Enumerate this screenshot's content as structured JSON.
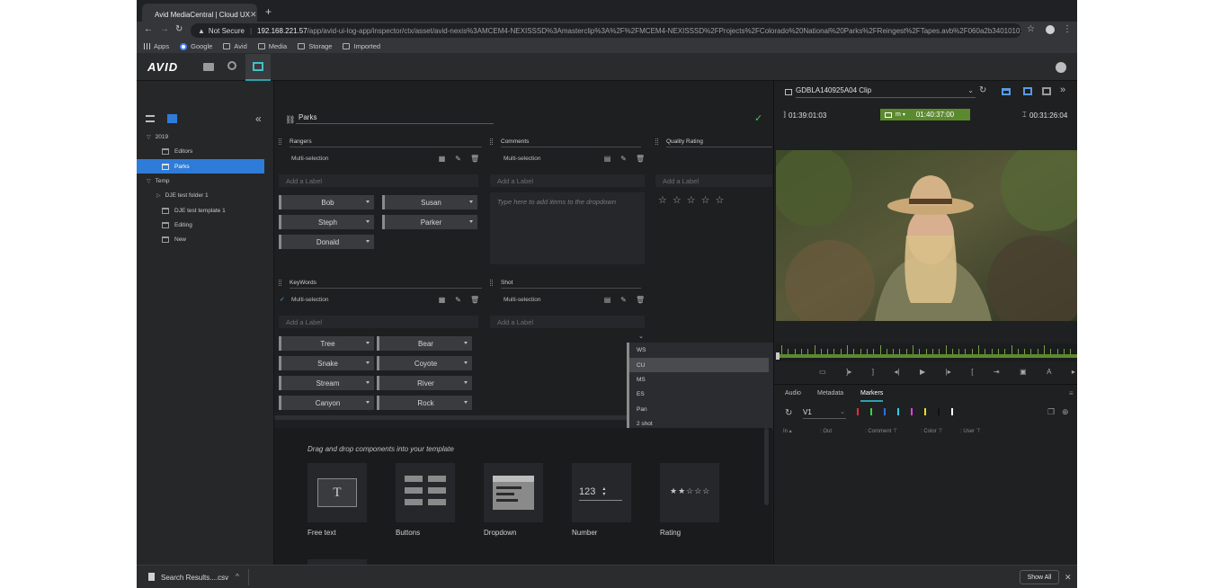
{
  "browser": {
    "tab_title": "Avid MediaCentral | Cloud UX",
    "security_label": "Not Secure",
    "url_host": "192.168.221.57",
    "url_path": "/app/avid-ui-log-app/inspector/ctx/asset/avid-nexis%3AMCEM4-NEXISSSD%3Amasterclip%3A%2F%2FMCEM4-NEXISSSD%2FProjects%2FColorado%20National%20Parks%2FReingest%2FTapes.avb%2F060a2b34010101...",
    "bookmarks": [
      "Apps",
      "Google",
      "Avid",
      "Media",
      "Storage",
      "Imported"
    ]
  },
  "app": {
    "logo": "AVID"
  },
  "tree": {
    "items": [
      {
        "label": "2019",
        "level": 0,
        "type": "folder"
      },
      {
        "label": "Editors",
        "level": 1,
        "type": "bin"
      },
      {
        "label": "Parks",
        "level": 1,
        "type": "bin",
        "selected": true
      },
      {
        "label": "Temp",
        "level": 0,
        "type": "folder"
      },
      {
        "label": "DJE test folder 1",
        "level": 1,
        "type": "folder"
      },
      {
        "label": "DJE test template 1",
        "level": 1,
        "type": "bin"
      },
      {
        "label": "Editing",
        "level": 1,
        "type": "bin"
      },
      {
        "label": "New",
        "level": 1,
        "type": "bin"
      }
    ]
  },
  "template": {
    "name": "Parks",
    "add_label_placeholder": "Add a Label",
    "multi_selection_label": "Multi-selection",
    "sections": {
      "rangers": {
        "title": "Rangers",
        "buttons": [
          "Bob",
          "Susan",
          "Steph",
          "Parker",
          "Donald"
        ]
      },
      "comments": {
        "title": "Comments",
        "placeholder": "Type here to add items to the dropdown"
      },
      "quality": {
        "title": "Quality Rating",
        "stars": 5
      },
      "keywords": {
        "title": "KeyWords",
        "buttons": [
          "Tree",
          "Bear",
          "Snake",
          "Coyote",
          "Stream",
          "River",
          "Canyon",
          "Rock"
        ]
      },
      "shot": {
        "title": "Shot",
        "options": [
          "WS",
          "CU",
          "MS",
          "ES",
          "Pan",
          "2 shot"
        ],
        "highlighted": "CU"
      }
    }
  },
  "components": {
    "hint": "Drag and drop components into your template",
    "items": [
      {
        "label": "Free text",
        "glyph": "T"
      },
      {
        "label": "Buttons",
        "glyph": ""
      },
      {
        "label": "Dropdown",
        "glyph": ""
      },
      {
        "label": "Number",
        "glyph": "123"
      },
      {
        "label": "Rating",
        "glyph": "★★☆☆☆"
      }
    ]
  },
  "player": {
    "clip_name": "GDBLA140925A04 Clip",
    "mark_in": "01:39:01:03",
    "position": "01:40:37:00",
    "position_mode": "m",
    "duration": "00:31:26:04",
    "tabs": [
      "Audio",
      "Metadata",
      "Markers"
    ],
    "active_tab": "Markers",
    "track": "V1",
    "marker_colors": [
      "#e03030",
      "#40d040",
      "#3070e0",
      "#30d0e0",
      "#e040e0",
      "#e0e030",
      "#111111",
      "#ffffff"
    ],
    "columns": [
      "In",
      "Out",
      "Comment",
      "Color",
      "User"
    ]
  },
  "downloads": {
    "file": "Search Results....csv",
    "show_all": "Show All"
  }
}
